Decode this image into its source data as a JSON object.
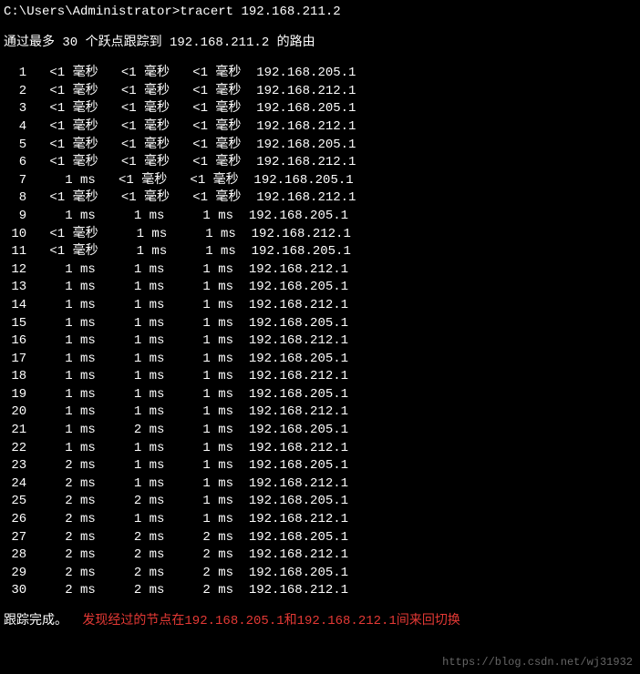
{
  "prompt": "C:\\Users\\Administrator>tracert  192.168.211.2",
  "header": "通过最多 30 个跃点跟踪到 192.168.211.2 的路由",
  "hops": [
    {
      "n": "1",
      "t1": "<1 毫秒",
      "t2": "<1 毫秒",
      "t3": "<1 毫秒",
      "ip": "192.168.205.1"
    },
    {
      "n": "2",
      "t1": "<1 毫秒",
      "t2": "<1 毫秒",
      "t3": "<1 毫秒",
      "ip": "192.168.212.1"
    },
    {
      "n": "3",
      "t1": "<1 毫秒",
      "t2": "<1 毫秒",
      "t3": "<1 毫秒",
      "ip": "192.168.205.1"
    },
    {
      "n": "4",
      "t1": "<1 毫秒",
      "t2": "<1 毫秒",
      "t3": "<1 毫秒",
      "ip": "192.168.212.1"
    },
    {
      "n": "5",
      "t1": "<1 毫秒",
      "t2": "<1 毫秒",
      "t3": "<1 毫秒",
      "ip": "192.168.205.1"
    },
    {
      "n": "6",
      "t1": "<1 毫秒",
      "t2": "<1 毫秒",
      "t3": "<1 毫秒",
      "ip": "192.168.212.1"
    },
    {
      "n": "7",
      "t1": "1 ms",
      "t2": "<1 毫秒",
      "t3": "<1 毫秒",
      "ip": "192.168.205.1"
    },
    {
      "n": "8",
      "t1": "<1 毫秒",
      "t2": "<1 毫秒",
      "t3": "<1 毫秒",
      "ip": "192.168.212.1"
    },
    {
      "n": "9",
      "t1": "1 ms",
      "t2": "1 ms",
      "t3": "1 ms",
      "ip": "192.168.205.1"
    },
    {
      "n": "10",
      "t1": "<1 毫秒",
      "t2": "1 ms",
      "t3": "1 ms",
      "ip": "192.168.212.1"
    },
    {
      "n": "11",
      "t1": "<1 毫秒",
      "t2": "1 ms",
      "t3": "1 ms",
      "ip": "192.168.205.1"
    },
    {
      "n": "12",
      "t1": "1 ms",
      "t2": "1 ms",
      "t3": "1 ms",
      "ip": "192.168.212.1"
    },
    {
      "n": "13",
      "t1": "1 ms",
      "t2": "1 ms",
      "t3": "1 ms",
      "ip": "192.168.205.1"
    },
    {
      "n": "14",
      "t1": "1 ms",
      "t2": "1 ms",
      "t3": "1 ms",
      "ip": "192.168.212.1"
    },
    {
      "n": "15",
      "t1": "1 ms",
      "t2": "1 ms",
      "t3": "1 ms",
      "ip": "192.168.205.1"
    },
    {
      "n": "16",
      "t1": "1 ms",
      "t2": "1 ms",
      "t3": "1 ms",
      "ip": "192.168.212.1"
    },
    {
      "n": "17",
      "t1": "1 ms",
      "t2": "1 ms",
      "t3": "1 ms",
      "ip": "192.168.205.1"
    },
    {
      "n": "18",
      "t1": "1 ms",
      "t2": "1 ms",
      "t3": "1 ms",
      "ip": "192.168.212.1"
    },
    {
      "n": "19",
      "t1": "1 ms",
      "t2": "1 ms",
      "t3": "1 ms",
      "ip": "192.168.205.1"
    },
    {
      "n": "20",
      "t1": "1 ms",
      "t2": "1 ms",
      "t3": "1 ms",
      "ip": "192.168.212.1"
    },
    {
      "n": "21",
      "t1": "1 ms",
      "t2": "2 ms",
      "t3": "1 ms",
      "ip": "192.168.205.1"
    },
    {
      "n": "22",
      "t1": "1 ms",
      "t2": "1 ms",
      "t3": "1 ms",
      "ip": "192.168.212.1"
    },
    {
      "n": "23",
      "t1": "2 ms",
      "t2": "1 ms",
      "t3": "1 ms",
      "ip": "192.168.205.1"
    },
    {
      "n": "24",
      "t1": "2 ms",
      "t2": "1 ms",
      "t3": "1 ms",
      "ip": "192.168.212.1"
    },
    {
      "n": "25",
      "t1": "2 ms",
      "t2": "2 ms",
      "t3": "1 ms",
      "ip": "192.168.205.1"
    },
    {
      "n": "26",
      "t1": "2 ms",
      "t2": "1 ms",
      "t3": "1 ms",
      "ip": "192.168.212.1"
    },
    {
      "n": "27",
      "t1": "2 ms",
      "t2": "2 ms",
      "t3": "2 ms",
      "ip": "192.168.205.1"
    },
    {
      "n": "28",
      "t1": "2 ms",
      "t2": "2 ms",
      "t3": "2 ms",
      "ip": "192.168.212.1"
    },
    {
      "n": "29",
      "t1": "2 ms",
      "t2": "2 ms",
      "t3": "2 ms",
      "ip": "192.168.205.1"
    },
    {
      "n": "30",
      "t1": "2 ms",
      "t2": "2 ms",
      "t3": "2 ms",
      "ip": "192.168.212.1"
    }
  ],
  "footer": "跟踪完成。",
  "annotation": "发现经过的节点在192.168.205.1和192.168.212.1间来回切换",
  "watermark": "https://blog.csdn.net/wj31932"
}
